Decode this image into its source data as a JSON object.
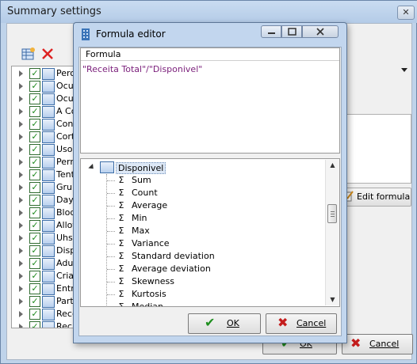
{
  "background_window": {
    "title": "Summary settings",
    "close_label": "✕",
    "toolbar": {
      "add_icon": "add-table-icon",
      "delete_icon": "red-x-icon"
    },
    "fields": [
      {
        "label": "Perc"
      },
      {
        "label": "Ocup"
      },
      {
        "label": "Ocup"
      },
      {
        "label": "A Co"
      },
      {
        "label": "Conf"
      },
      {
        "label": "Corte"
      },
      {
        "label": "Uso"
      },
      {
        "label": "Perm"
      },
      {
        "label": "Tenta"
      },
      {
        "label": "Grup"
      },
      {
        "label": "Day"
      },
      {
        "label": "Bloq"
      },
      {
        "label": "Allot"
      },
      {
        "label": "Uhs"
      },
      {
        "label": "Disp"
      },
      {
        "label": "Adul"
      },
      {
        "label": "Crian"
      },
      {
        "label": "Entra"
      },
      {
        "label": "Parti"
      },
      {
        "label": "Rece"
      },
      {
        "label": "Rec"
      }
    ],
    "edit_formula_label": "Edit formula",
    "ok_label": "OK",
    "cancel_label": "Cancel"
  },
  "dialog": {
    "title": "Formula editor",
    "formula_header": "Formula",
    "formula_text": "\"Receita Total\"/\"Disponivel\"",
    "tree_root": "Disponivel",
    "functions": [
      "Sum",
      "Count",
      "Average",
      "Min",
      "Max",
      "Variance",
      "Standard deviation",
      "Average deviation",
      "Skewness",
      "Kurtosis",
      "Median"
    ],
    "sigma": "Σ",
    "ok_label": "OK",
    "cancel_label": "Cancel"
  }
}
